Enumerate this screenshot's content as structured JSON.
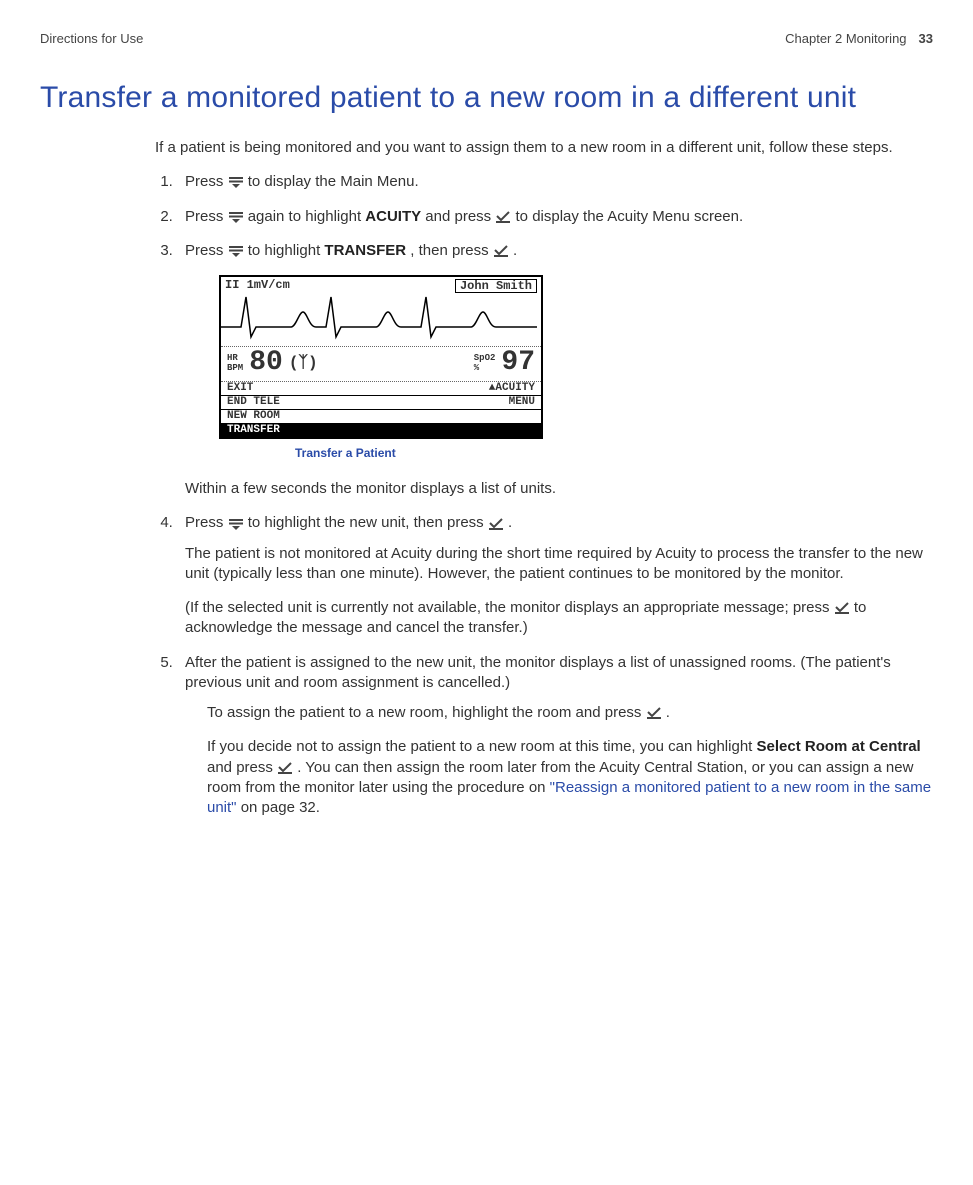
{
  "header": {
    "left": "Directions for Use",
    "chapter": "Chapter 2   Monitoring",
    "page": "33"
  },
  "title": "Transfer a monitored patient to a new room in a different unit",
  "intro": "If a patient is being monitored and you want to assign them to a new room in a different unit, follow these steps.",
  "steps": {
    "s1_a": "Press ",
    "s1_b": " to display the Main Menu.",
    "s2_a": "Press ",
    "s2_b": " again to highlight ",
    "s2_bold": "ACUITY",
    "s2_c": " and press ",
    "s2_d": " to display the Acuity Menu screen.",
    "s3_a": "Press ",
    "s3_b": " to highlight ",
    "s3_bold": "TRANSFER",
    "s3_c": ", then press ",
    "s3_d": ".",
    "s3_after": "Within a few seconds the monitor displays a list of units.",
    "s4_a": "Press ",
    "s4_b": " to highlight the new unit, then press ",
    "s4_c": ".",
    "s4_p1": "The patient is not monitored at Acuity during the short time required by Acuity to process the transfer to the new unit (typically less than one minute). However, the patient continues to be monitored by the monitor.",
    "s4_p2a": "(If the selected unit is currently not available, the monitor displays an appropriate message; press ",
    "s4_p2b": " to acknowledge the message and cancel the transfer.)",
    "s5_a": "After the patient is assigned to the new unit, the monitor displays a list of unassigned rooms. (The patient's previous unit and room assignment is cancelled.)",
    "s5_sub1a": "To assign the patient to a new room, highlight the room and press ",
    "s5_sub1b": ".",
    "s5_sub2a": "If you decide not to assign the patient to a new room at this time, you can highlight ",
    "s5_sub2_bold": "Select Room at Central",
    "s5_sub2b": " and press ",
    "s5_sub2c": ". You can then assign the room later from the Acuity Central Station, or you can assign a new room from the monitor later using the procedure on ",
    "s5_sub2_link": "\"Reassign a monitored patient to a new room in the same unit\"",
    "s5_sub2d": " on page 32."
  },
  "screen": {
    "lead": "II 1mV/cm",
    "patient": "John Smith",
    "hr_label1": "HR",
    "hr_label2": "BPM",
    "hr_val": "80",
    "spo2_label1": "SpO2",
    "spo2_label2": "%",
    "spo2_val": "97",
    "menu": {
      "exit": "EXIT",
      "acuity1": "ACUITY",
      "end_tele": "END TELE",
      "acuity2": "MENU",
      "new_room": "NEW ROOM",
      "transfer": "TRANSFER"
    },
    "caption": "Transfer a Patient"
  }
}
